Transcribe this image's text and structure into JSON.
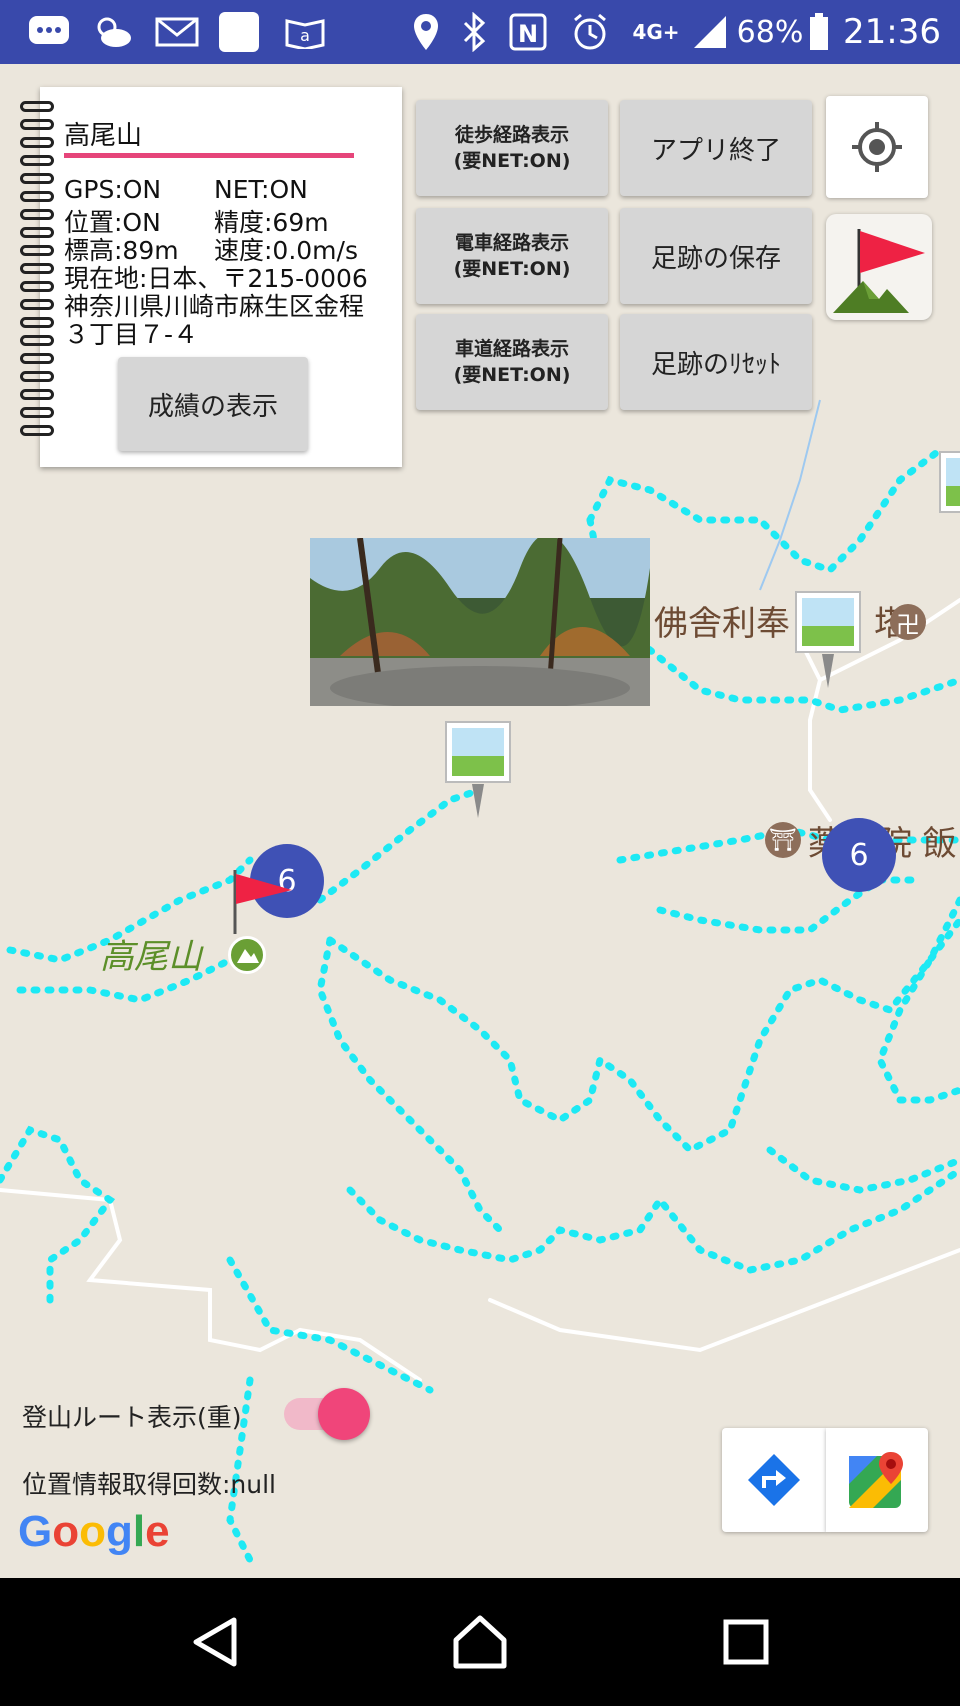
{
  "status_bar": {
    "battery": "68%",
    "time": "21:36",
    "network": "4G+"
  },
  "info_panel": {
    "title": "高尾山",
    "gps": "GPS:ON",
    "net": "NET:ON",
    "position": "位置:ON",
    "accuracy": "精度:69m",
    "altitude": "標高:89m",
    "speed": "速度:0.0m/s",
    "address_line1": "現在地:日本、〒215-0006",
    "address_line2": "神奈川県川崎市麻生区金程",
    "address_line3": "３丁目７-４",
    "score_button": "成績の表示"
  },
  "buttons": {
    "walk_route": [
      "徒歩経路表示",
      "(要NET:ON)"
    ],
    "train_route": [
      "電車経路表示",
      "(要NET:ON)"
    ],
    "car_route": [
      "車道経路表示",
      "(要NET:ON)"
    ],
    "exit_app": "アプリ終了",
    "save_footprints": "足跡の保存",
    "reset_footprints": "足跡のﾘｾｯﾄ"
  },
  "map": {
    "labels": {
      "mountain": "高尾山",
      "temple": "佛舎利奉",
      "temple_suffix": "塔",
      "shrine": "薬",
      "shrine_suffix": "院 飯"
    },
    "clusters": [
      "6",
      "6"
    ],
    "google_logo": "Google"
  },
  "bottom": {
    "route_toggle_label": "登山ルート表示(重)",
    "route_toggle_on": true,
    "location_count": "位置情報取得回数:null"
  },
  "colors": {
    "status_bar": "#3949ab",
    "trail": "#1de9f4",
    "cluster": "#3f51b5",
    "accent": "#f0457a"
  }
}
